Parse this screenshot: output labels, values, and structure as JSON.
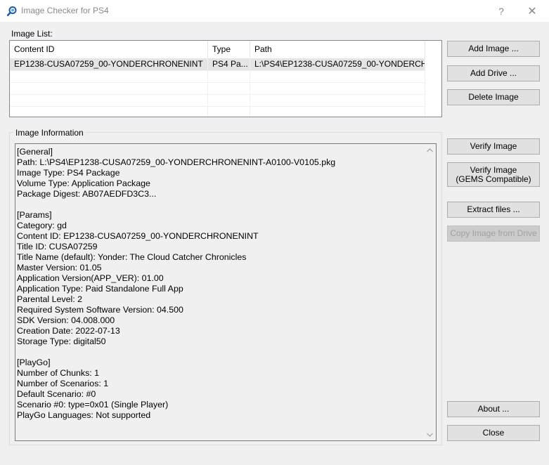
{
  "window": {
    "title": "Image Checker for PS4",
    "help_glyph": "?",
    "close_glyph": "✕"
  },
  "image_list": {
    "label": "Image List:",
    "columns": [
      "Content ID",
      "Type",
      "Path"
    ],
    "rows": [
      {
        "content_id": "EP1238-CUSA07259_00-YONDERCHRONENINT",
        "type": "PS4 Pa...",
        "path": "L:\\PS4\\EP1238-CUSA07259_00-YONDERCHR..."
      }
    ]
  },
  "image_info": {
    "label": "Image Information",
    "text": "[General]\nPath: L:\\PS4\\EP1238-CUSA07259_00-YONDERCHRONENINT-A0100-V0105.pkg\nImage Type: PS4 Package\nVolume Type: Application Package\nPackage Digest: AB07AEDFD3C3...\n\n[Params]\nCategory: gd\nContent ID: EP1238-CUSA07259_00-YONDERCHRONENINT\nTitle ID: CUSA07259\nTitle Name (default): Yonder: The Cloud Catcher Chronicles\nMaster Version: 01.05\nApplication Version(APP_VER): 01.00\nApplication Type: Paid Standalone Full App\nParental Level: 2\nRequired System Software Version: 04.500\nSDK Version: 04.008.000\nCreation Date: 2022-07-13\nStorage Type: digital50\n\n[PlayGo]\nNumber of Chunks: 1\nNumber of Scenarios: 1\nDefault Scenario: #0\nScenario #0: type=0x01 (Single Player)\nPlayGo Languages: Not supported"
  },
  "buttons": {
    "add_image": "Add Image ...",
    "add_drive": "Add Drive ...",
    "delete_image": "Delete Image",
    "verify_image": "Verify Image",
    "verify_gems_line1": "Verify Image",
    "verify_gems_line2": "(GEMS Compatible)",
    "extract_files": "Extract files ...",
    "copy_from_drive": "Copy Image from Drive",
    "about": "About ...",
    "close": "Close"
  },
  "icons": {
    "app": "magnifier-icon",
    "scroll_up": "scroll-up-arrow-icon",
    "scroll_down": "scroll-down-arrow-icon"
  },
  "colors": {
    "window_bg": "#f0f0f0",
    "button_bg": "#e1e1e1",
    "selected_row": "#e5e5e5",
    "disabled_text": "#a0a0a0"
  }
}
